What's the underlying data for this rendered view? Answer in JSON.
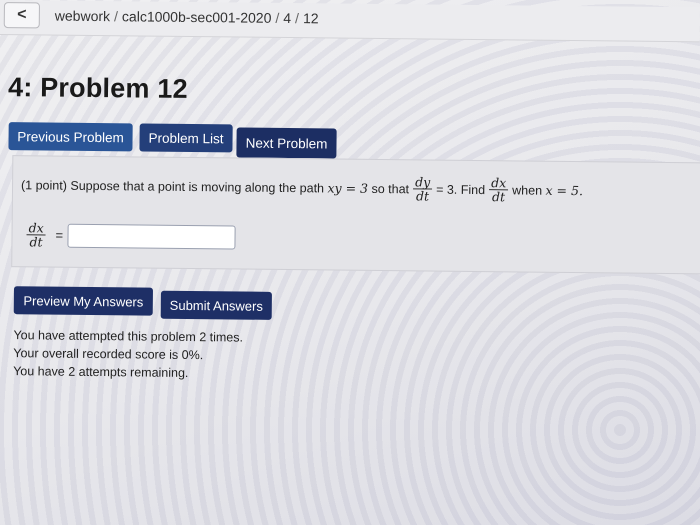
{
  "breadcrumb": {
    "back_icon": "chevron-left-icon",
    "back_glyph": "<",
    "items": [
      "webwork",
      "calc1000b-sec001-2020",
      "4",
      "12"
    ]
  },
  "title": "4: Problem 12",
  "nav": {
    "previous": "Previous Problem",
    "list": "Problem List",
    "next": "Next Problem"
  },
  "problem": {
    "points": "(1 point)",
    "text1": "Suppose that a point is moving along the path",
    "eq1": "xy = 3",
    "text2": "so that",
    "frac1_num": "dy",
    "frac1_den": "dt",
    "eq2": "= 3.",
    "text3": "Find",
    "frac2_num": "dx",
    "frac2_den": "dt",
    "text4": "when",
    "eq3": "x = 5.",
    "answer_label_num": "dx",
    "answer_label_den": "dt",
    "answer_equals": "=",
    "answer_value": ""
  },
  "actions": {
    "preview": "Preview My Answers",
    "submit": "Submit Answers"
  },
  "status": {
    "line1": "You have attempted this problem 2 times.",
    "line2": "Your overall recorded score is 0%.",
    "line3": "You have 2 attempts remaining."
  },
  "colors": {
    "button_primary": "#1e2f66",
    "button_prev": "#2a5597"
  }
}
